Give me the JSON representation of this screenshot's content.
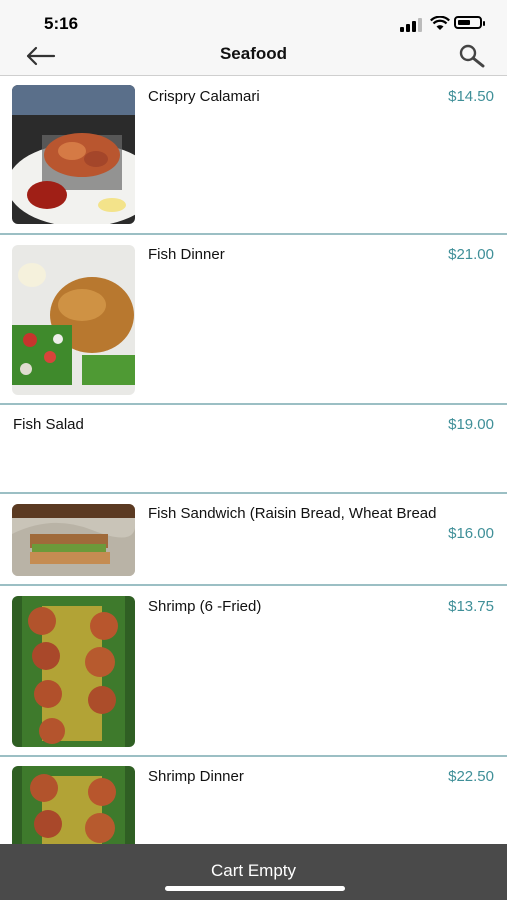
{
  "status": {
    "time": "5:16"
  },
  "nav": {
    "title": "Seafood"
  },
  "items": [
    {
      "name": "Crispry Calamari",
      "price": "$14.50"
    },
    {
      "name": "Fish Dinner",
      "price": "$21.00"
    },
    {
      "name": "Fish Salad",
      "price": "$19.00"
    },
    {
      "name": "Fish Sandwich (Raisin Bread, Wheat Bread",
      "price": "$16.00"
    },
    {
      "name": "Shrimp (6 -Fried)",
      "price": "$13.75"
    },
    {
      "name": "Shrimp Dinner",
      "price": "$22.50"
    }
  ],
  "cart": {
    "label": "Cart Empty"
  },
  "colors": {
    "accent": "#3f8f98",
    "divider": "#9bbfc4",
    "cart_bar": "#4a4a4a"
  }
}
